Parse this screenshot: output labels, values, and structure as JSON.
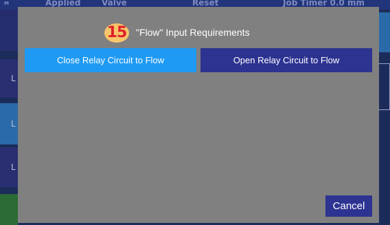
{
  "background": {
    "header_items": [
      "M",
      "Applied",
      "Valve",
      "Reset",
      "Job Timer 0.0 mm"
    ],
    "tile_letter": "L"
  },
  "dialog": {
    "step_number": "15",
    "title": "\"Flow\" Input Requirements",
    "options": [
      {
        "label": "Close Relay Circuit to Flow"
      },
      {
        "label": "Open Relay Circuit to Flow"
      }
    ],
    "cancel_label": "Cancel"
  },
  "colors": {
    "overlay": "#808080",
    "primary_selected": "#1f9af4",
    "primary": "#2d3391",
    "badge_bg": "#f7c66a",
    "badge_text": "#e0202a"
  }
}
